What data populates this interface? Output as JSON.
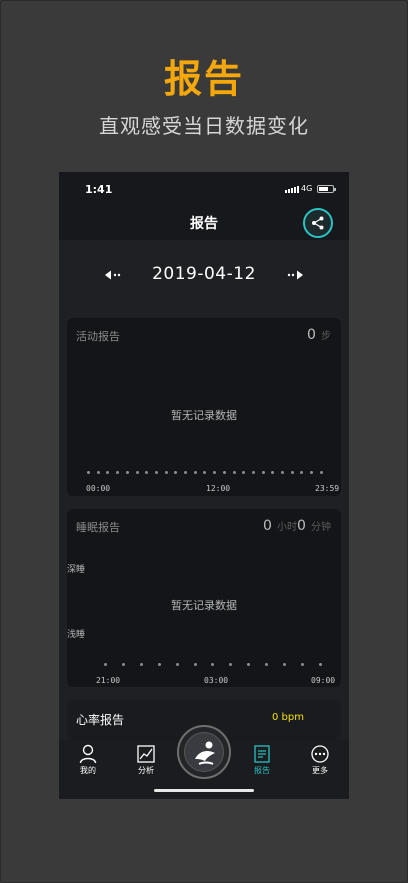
{
  "promo": {
    "title": "报告",
    "subtitle": "直观感受当日数据变化"
  },
  "status_bar": {
    "time": "1:41",
    "network": "4G"
  },
  "nav": {
    "title": "报告",
    "share_icon": "share-icon"
  },
  "date": {
    "value": "2019-04-12",
    "prev_icon": "arrow-left-icon",
    "next_icon": "arrow-right-icon"
  },
  "activity": {
    "title": "活动报告",
    "value": "0",
    "unit": "步",
    "empty": "暂无记录数据",
    "ticks": [
      "00:00",
      "12:00",
      "23:59"
    ]
  },
  "sleep": {
    "title": "睡眠报告",
    "hours": "0",
    "hours_unit": "小时",
    "minutes": "0",
    "minutes_unit": "分钟",
    "deep": "深睡",
    "light": "浅睡",
    "empty": "暂无记录数据",
    "ticks": [
      "21:00",
      "03:00",
      "09:00"
    ]
  },
  "heart": {
    "title": "心率报告",
    "value": "0 bpm"
  },
  "tabs": [
    {
      "label": "我的",
      "icon": "person-icon"
    },
    {
      "label": "分析",
      "icon": "chart-icon"
    },
    {
      "label": "报告",
      "icon": "report-icon",
      "active": true
    },
    {
      "label": "更多",
      "icon": "more-icon"
    }
  ],
  "colors": {
    "accent": "#29c3c3",
    "promo_title": "#f5a80c",
    "heart_value": "#f2e00b"
  }
}
